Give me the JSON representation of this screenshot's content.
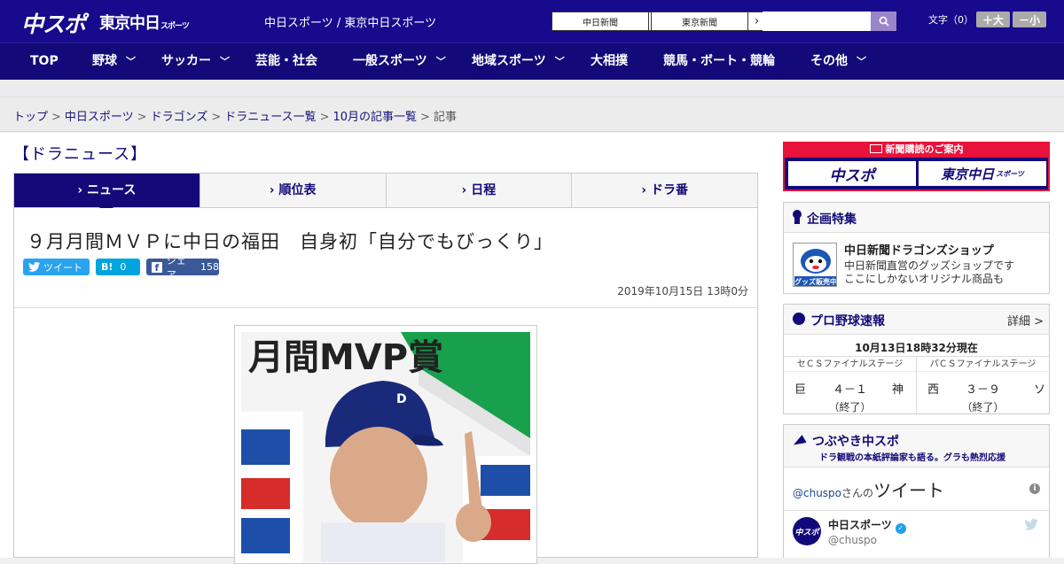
{
  "header": {
    "logo_chuspo": "中スポ",
    "logo_tokyo": "東京中日",
    "logo_tokyo_small": "スポーツ",
    "site_title": "中日スポーツ / 東京中日スポーツ",
    "ext_links": [
      "中日新聞",
      "東京新聞"
    ],
    "font_size_label": "文字（0）",
    "font_larger": "＋大",
    "font_smaller": "－小"
  },
  "nav": {
    "items": [
      {
        "label": "TOP",
        "has_menu": false
      },
      {
        "label": "野球",
        "has_menu": true
      },
      {
        "label": "サッカー",
        "has_menu": true
      },
      {
        "label": "芸能・社会",
        "has_menu": false
      },
      {
        "label": "一般スポーツ",
        "has_menu": true
      },
      {
        "label": "地域スポーツ",
        "has_menu": true
      },
      {
        "label": "大相撲",
        "has_menu": false
      },
      {
        "label": "競馬・ボート・競輪",
        "has_menu": false
      },
      {
        "label": "その他",
        "has_menu": true
      }
    ]
  },
  "breadcrumb": {
    "items": [
      "トップ",
      "中日スポーツ",
      "ドラゴンズ",
      "ドラニュース一覧",
      "10月の記事一覧"
    ],
    "current": "記事"
  },
  "section_title": "【ドラニュース】",
  "tabs": [
    {
      "label": "ニュース",
      "active": true
    },
    {
      "label": "順位表",
      "active": false
    },
    {
      "label": "日程",
      "active": false
    },
    {
      "label": "ドラ番",
      "active": false
    }
  ],
  "article": {
    "headline": "９月月間ＭＶＰに中日の福田　自身初「自分でもびっくり」",
    "share": {
      "tweet": "ツイート",
      "hatena": "B!",
      "hatena_count": "0",
      "facebook": "シェア",
      "facebook_count": "158"
    },
    "date": "2019年10月15日 13時0分"
  },
  "sidebar": {
    "subscribe": {
      "title": "新聞購読のご案内",
      "buttons": [
        "中スポ",
        "東京中日"
      ],
      "button_small": "スポーツ"
    },
    "kikaku": {
      "title": "企画特集",
      "shop_title": "中日新聞ドラゴンズショップ",
      "shop_desc_1": "中日新聞直営のグッズショップです",
      "shop_desc_2": "ここにしかないオリジナル商品も",
      "thumb_label": "グッズ販売中"
    },
    "baseball": {
      "title": "プロ野球速報",
      "detail": "詳細 >",
      "time": "10月13日18時32分現在",
      "games": [
        {
          "stage": "セＣＳファイナルステージ",
          "home": "巨",
          "score": "４－１",
          "away": "神",
          "status": "（終了）"
        },
        {
          "stage": "パＣＳファイナルステージ",
          "home": "西",
          "score": "３－９",
          "away": "ソ",
          "status": "（終了）"
        }
      ]
    },
    "tsubuyaki": {
      "title": "つぶやき中スポ",
      "subtitle": "ドラ観戦の本紙評論家も語る。グラも熱烈応援",
      "handle_prefix": "@chuspo",
      "handle_suffix": "さんの",
      "tweets_word": "ツイート",
      "account_name": "中日スポーツ",
      "account_handle": "@chuspo",
      "avatar_text": "中スポ"
    }
  },
  "colors": {
    "brand_navy": "#170a8c",
    "nav_navy": "#120a78",
    "subscribe_red": "#e8123b"
  }
}
